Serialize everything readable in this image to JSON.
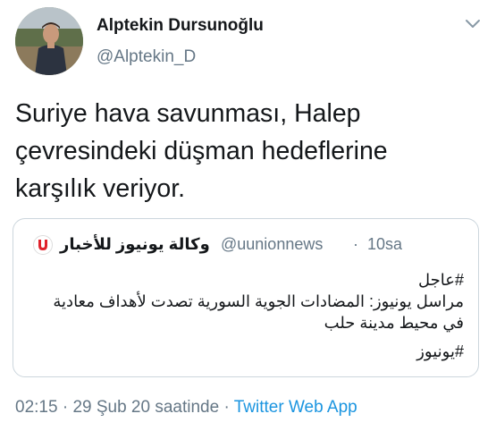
{
  "author": {
    "display_name": "Alptekin Dursunoğlu",
    "handle": "@Alptekin_D"
  },
  "tweet": {
    "text_lines": [
      "Suriye hava savunması, Halep",
      "çevresindeki düşman hedeflerine",
      "karşılık veriyor."
    ]
  },
  "quoted": {
    "name": "وكالة يونيوز للأخبار",
    "handle": "@uunionnews",
    "separator": "·",
    "time": "10sa",
    "body_lines": [
      "#عاجل",
      "مراسل يونيوز: المضادات الجوية السورية تصدت لأهداف معادية",
      "في محيط مدينة حلب",
      "#يونيوز"
    ]
  },
  "meta": {
    "time": "02:15",
    "dot1": "·",
    "date": "29 Şub 20 saatinde",
    "dot2": "·",
    "source": "Twitter Web App"
  },
  "colors": {
    "text": "#14171a",
    "secondary": "#657786",
    "link": "#1b95e0",
    "border": "#ccd6dd",
    "logo_red": "#e0212b"
  },
  "icons": {
    "avatar": "profile-photo",
    "caret": "chevron-down-icon",
    "quote_logo": "uunion-logo-icon"
  }
}
